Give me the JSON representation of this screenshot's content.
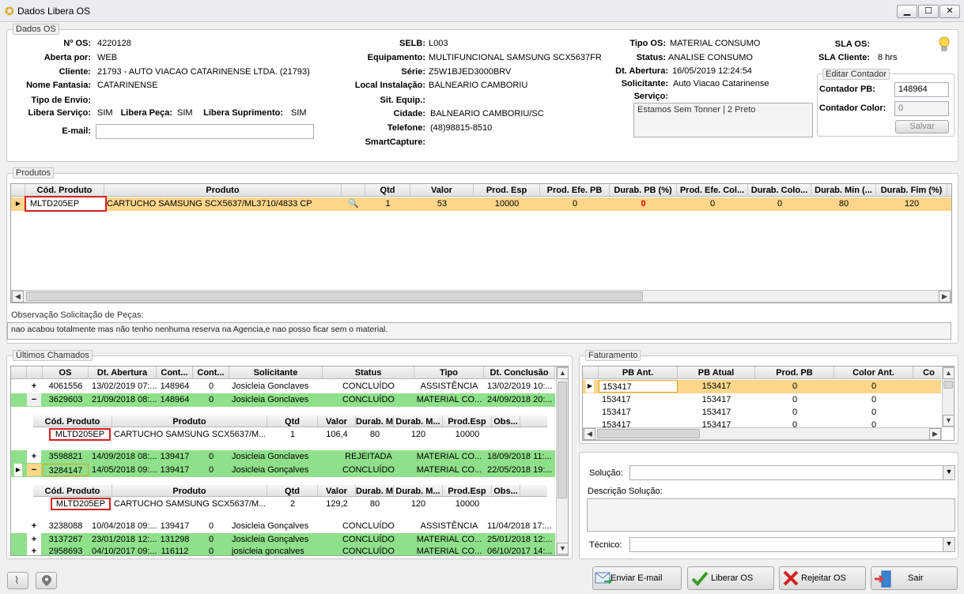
{
  "window": {
    "title": "Dados Libera OS",
    "min": "▁",
    "max": "☐",
    "close": "✕"
  },
  "dados_os": {
    "title": "Dados OS",
    "n_os_label": "Nº OS:",
    "n_os": "4220128",
    "aberta_por_label": "Aberta por:",
    "aberta_por": "WEB",
    "cliente_label": "Cliente:",
    "cliente": "21793 - AUTO VIACAO CATARINENSE LTDA. (21793)",
    "nome_fantasia_label": "Nome Fantasia:",
    "nome_fantasia": "CATARINENSE",
    "tipo_envio_label": "Tipo de Envio:",
    "tipo_envio": "",
    "libera_servico_label": "Libera Serviço:",
    "libera_servico": "SIM",
    "libera_peca_label": "Libera Peça:",
    "libera_peca": "SIM",
    "libera_suprimento_label": "Libera Suprimento:",
    "libera_suprimento": "SIM",
    "email_label": "E-mail:",
    "email": "",
    "selb_label": "SELB:",
    "selb": "L003",
    "equipamento_label": "Equipamento:",
    "equipamento": "MULTIFUNCIONAL SAMSUNG SCX5637FR",
    "serie_label": "Série:",
    "serie": "Z5W1BJED3000BRV",
    "local_instalacao_label": "Local Instalação:",
    "local_instalacao": "BALNEARIO CAMBORIU",
    "sit_equip_label": "Sit. Equip.:",
    "sit_equip": "",
    "cidade_label": "Cidade:",
    "cidade": "BALNEARIO CAMBORIU/SC",
    "telefone_label": "Telefone:",
    "telefone": "(48)98815-8510",
    "smartcapture_label": "SmartCapture:",
    "smartcapture": "",
    "tipo_os_label": "Tipo OS:",
    "tipo_os": "MATERIAL CONSUMO",
    "status_label": "Status:",
    "status": "ANALISE CONSUMO",
    "dt_abertura_label": "Dt. Abertura:",
    "dt_abertura": "16/05/2019 12:24:54",
    "solicitante_label": "Solicitante:",
    "solicitante": "Auto Viacao Catarinense",
    "servico_label": "Serviço:",
    "servico": "Estamos Sem Tonner | 2 Preto",
    "sla_os_label": "SLA OS:",
    "sla_os": "",
    "sla_cliente_label": "SLA Cliente:",
    "sla_cliente": "8 hrs",
    "editar_contador": {
      "title": "Editar Contador",
      "pb_label": "Contador PB:",
      "pb": "148964",
      "color_label": "Contador Color:",
      "color": "0",
      "salvar": "Salvar"
    }
  },
  "produtos": {
    "title": "Produtos",
    "columns": [
      "Cód. Produto",
      "Produto",
      "",
      "Qtd",
      "Valor",
      "Prod. Esp",
      "Prod. Efe. PB",
      "Durab. PB (%)",
      "Prod. Efe. Col...",
      "Durab. Colo...",
      "Durab. Min (...",
      "Durab. Fim (%)"
    ],
    "row": {
      "cod": "MLTD205EP",
      "produto": "CARTUCHO SAMSUNG SCX5637/ML3710/4833 CP",
      "qtd": "1",
      "valor": "53",
      "prod_esp": "10000",
      "prod_efe_pb": "0",
      "durab_pb": "0",
      "prod_efe_col": "0",
      "durab_colo": "0",
      "durab_min": "80",
      "durab_fim": "120"
    },
    "obs_label": "Observação Solicitação de Peças:",
    "obs": "nao acabou totalmente mas não tenho nenhuma reserva na Agencia,e nao posso ficar sem o material."
  },
  "ultimos": {
    "title": "Últimos Chamados",
    "columns": [
      "OS",
      "Dt. Abertura",
      "Cont...",
      "Cont...",
      "Solicitante",
      "Status",
      "Tipo",
      "Dt. Conclusão"
    ],
    "rows": [
      {
        "exp": "+",
        "os": "4061556",
        "dt": "13/02/2019 07:...",
        "c1": "148964",
        "c2": "0",
        "sol": "Josicleia Gonclaves",
        "status": "CONCLUÍDO",
        "tipo": "ASSISTÊNCIA",
        "conc": "13/02/2019 10:..."
      },
      {
        "exp": "−",
        "os": "3629603",
        "dt": "21/09/2018 08:...",
        "c1": "148964",
        "c2": "0",
        "sol": "Josicleia Gonclaves",
        "status": "CONCLUÍDO",
        "tipo": "MATERIAL CO...",
        "conc": "24/09/2018 20:..."
      },
      {
        "exp": "+",
        "os": "3598821",
        "dt": "14/09/2018 08:...",
        "c1": "139417",
        "c2": "0",
        "sol": "Josicleia Gonclaves",
        "status": "REJEITADA",
        "tipo": "MATERIAL CO...",
        "conc": "18/09/2018 11:..."
      },
      {
        "exp": "−",
        "os": "3284147",
        "dt": "14/05/2018 09:...",
        "c1": "139417",
        "c2": "0",
        "sol": "Josicleia Gonçalves",
        "status": "CONCLUÍDO",
        "tipo": "MATERIAL CO...",
        "conc": "22/05/2018 19:..."
      },
      {
        "exp": "+",
        "os": "3238088",
        "dt": "10/04/2018 09:...",
        "c1": "139417",
        "c2": "0",
        "sol": "Josicleia Gonçalves",
        "status": "CONCLUÍDO",
        "tipo": "ASSISTÊNCIA",
        "conc": "11/04/2018 17:..."
      },
      {
        "exp": "+",
        "os": "3137267",
        "dt": "23/01/2018 12:...",
        "c1": "131298",
        "c2": "0",
        "sol": "Josicleia Gonçalves",
        "status": "CONCLUÍDO",
        "tipo": "MATERIAL CO...",
        "conc": "25/01/2018 12:..."
      },
      {
        "exp": "+",
        "os": "2958693",
        "dt": "04/10/2017 09:...",
        "c1": "116112",
        "c2": "0",
        "sol": "josicleia goncalves",
        "status": "CONCLUÍDO",
        "tipo": "MATERIAL CO...",
        "conc": "06/10/2017 14:..."
      }
    ],
    "sub_columns": [
      "Cód. Produto",
      "Produto",
      "Qtd",
      "Valor",
      "Durab. M...",
      "Durab. M...",
      "Prod.Esp",
      "Obs..."
    ],
    "sub1": {
      "cod": "MLTD205EP",
      "produto": "CARTUCHO  SAMSUNG  SCX5637/M...",
      "qtd": "1",
      "valor": "106,4",
      "dm1": "80",
      "dm2": "120",
      "esp": "10000"
    },
    "sub2": {
      "cod": "MLTD205EP",
      "produto": "CARTUCHO  SAMSUNG  SCX5637/M...",
      "qtd": "2",
      "valor": "129,2",
      "dm1": "80",
      "dm2": "120",
      "esp": "10000"
    }
  },
  "faturamento": {
    "title": "Faturamento",
    "columns": [
      "PB Ant.",
      "PB Atual",
      "Prod. PB",
      "Color Ant.",
      "Co"
    ],
    "rows": [
      [
        "153417",
        "153417",
        "0",
        "0"
      ],
      [
        "153417",
        "153417",
        "0",
        "0"
      ],
      [
        "153417",
        "153417",
        "0",
        "0"
      ],
      [
        "153417",
        "153417",
        "0",
        "0"
      ]
    ]
  },
  "solucao": {
    "solucao_label": "Solução:",
    "descricao_label": "Descrição Solução:",
    "tecnico_label": "Técnico:"
  },
  "buttons": {
    "enviar": "Enviar E-mail",
    "liberar": "Liberar OS",
    "rejeitar": "Rejeitar OS",
    "sair": "Sair"
  },
  "icons": {
    "lamp": "lightbulb-icon",
    "attach": "paperclip-icon",
    "pin": "location-pin-icon"
  }
}
